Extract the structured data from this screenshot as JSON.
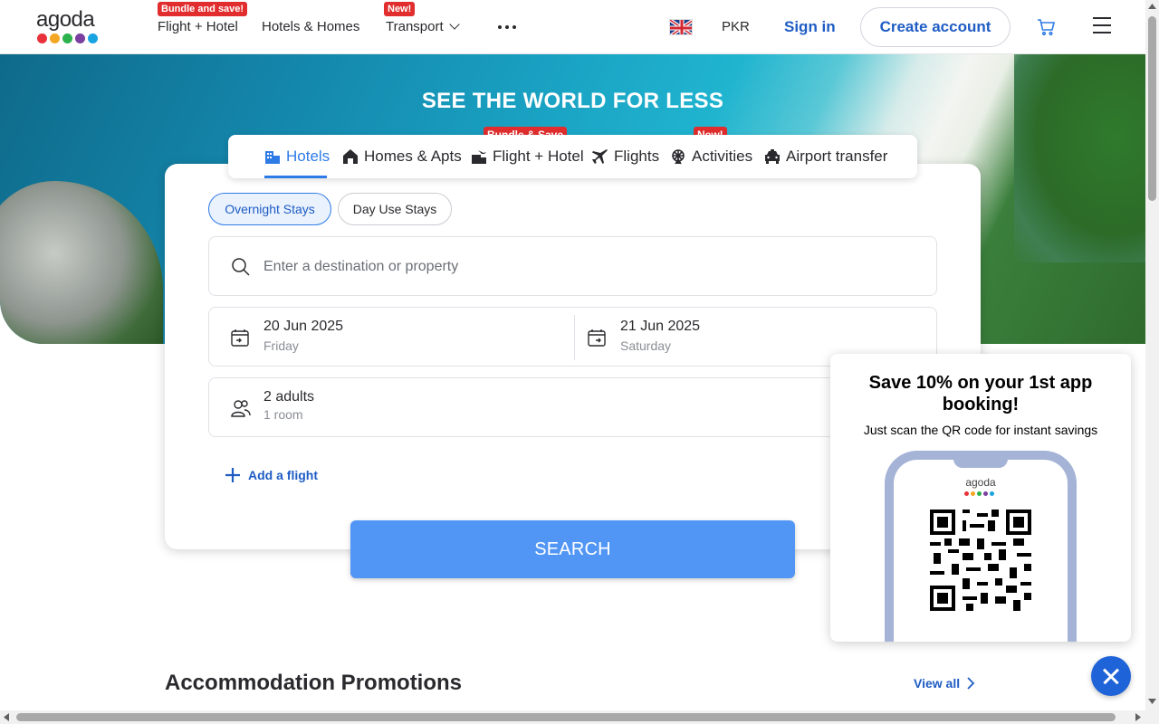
{
  "header": {
    "logo_text": "agoda",
    "logo_colors": [
      "#e8313a",
      "#f5a623",
      "#2bb24c",
      "#7b3fa0",
      "#1aa3e1"
    ],
    "nav": [
      {
        "label": "Flight + Hotel",
        "badge": "Bundle and save!"
      },
      {
        "label": "Hotels & Homes",
        "badge": ""
      },
      {
        "label": "Transport",
        "badge": "New!"
      }
    ],
    "currency": "PKR",
    "sign_in": "Sign in",
    "create_account": "Create account"
  },
  "hero": {
    "title": "SEE THE WORLD FOR LESS"
  },
  "search": {
    "tabs": [
      {
        "label": "Hotels",
        "active": true,
        "badge": ""
      },
      {
        "label": "Homes & Apts",
        "active": false,
        "badge": ""
      },
      {
        "label": "Flight + Hotel",
        "active": false,
        "badge": "Bundle & Save"
      },
      {
        "label": "Flights",
        "active": false,
        "badge": ""
      },
      {
        "label": "Activities",
        "active": false,
        "badge": "New!"
      },
      {
        "label": "Airport transfer",
        "active": false,
        "badge": ""
      }
    ],
    "stay_types": [
      "Overnight Stays",
      "Day Use Stays"
    ],
    "destination_placeholder": "Enter a destination or property",
    "check_in": {
      "date": "20 Jun 2025",
      "day": "Friday"
    },
    "check_out": {
      "date": "21 Jun 2025",
      "day": "Saturday"
    },
    "occupancy": {
      "guests": "2 adults",
      "rooms": "1 room"
    },
    "add_flight": "Add a flight",
    "search_button": "SEARCH"
  },
  "promotions": {
    "title": "Accommodation Promotions",
    "view_all": "View all"
  },
  "app_popup": {
    "title": "Save 10% on your 1st app booking!",
    "subtitle": "Just scan the QR code for instant savings",
    "phone_logo": "agoda"
  },
  "colors": {
    "accent": "#2f7be6",
    "link": "#1e5cc4",
    "badge": "#e12d2d",
    "search_button": "#5296f5"
  }
}
